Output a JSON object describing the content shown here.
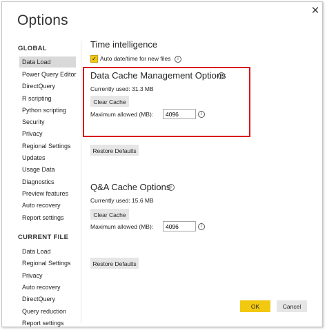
{
  "dialog": {
    "title": "Options",
    "close_glyph": "✕"
  },
  "sidebar": {
    "global_header": "GLOBAL",
    "global_items": [
      {
        "label": "Data Load",
        "selected": true
      },
      {
        "label": "Power Query Editor"
      },
      {
        "label": "DirectQuery"
      },
      {
        "label": "R scripting"
      },
      {
        "label": "Python scripting"
      },
      {
        "label": "Security"
      },
      {
        "label": "Privacy"
      },
      {
        "label": "Regional Settings"
      },
      {
        "label": "Updates"
      },
      {
        "label": "Usage Data"
      },
      {
        "label": "Diagnostics"
      },
      {
        "label": "Preview features"
      },
      {
        "label": "Auto recovery"
      },
      {
        "label": "Report settings"
      }
    ],
    "current_file_header": "CURRENT FILE",
    "current_file_items": [
      {
        "label": "Data Load"
      },
      {
        "label": "Regional Settings"
      },
      {
        "label": "Privacy"
      },
      {
        "label": "Auto recovery"
      },
      {
        "label": "DirectQuery"
      },
      {
        "label": "Query reduction"
      },
      {
        "label": "Report settings"
      }
    ]
  },
  "time_intelligence": {
    "heading": "Time intelligence",
    "auto_datetime_label": "Auto date/time for new files",
    "auto_datetime_checked": true
  },
  "data_cache": {
    "heading": "Data Cache Management Options",
    "currently_used": "Currently used: 31.3 MB",
    "clear_label": "Clear Cache",
    "max_label": "Maximum allowed (MB):",
    "max_value": "4096"
  },
  "restore_defaults_label": "Restore Defaults",
  "qa_cache": {
    "heading": "Q&A Cache Options",
    "currently_used": "Currently used: 15.6 MB",
    "clear_label": "Clear Cache",
    "max_label": "Maximum allowed (MB):",
    "max_value": "4096"
  },
  "footer": {
    "ok_label": "OK",
    "cancel_label": "Cancel"
  },
  "icons": {
    "info": "i",
    "check": "✓"
  },
  "colors": {
    "accent_yellow": "#f2c811",
    "highlight_red": "#d9151b",
    "selected_bg": "#d9d9d9"
  }
}
